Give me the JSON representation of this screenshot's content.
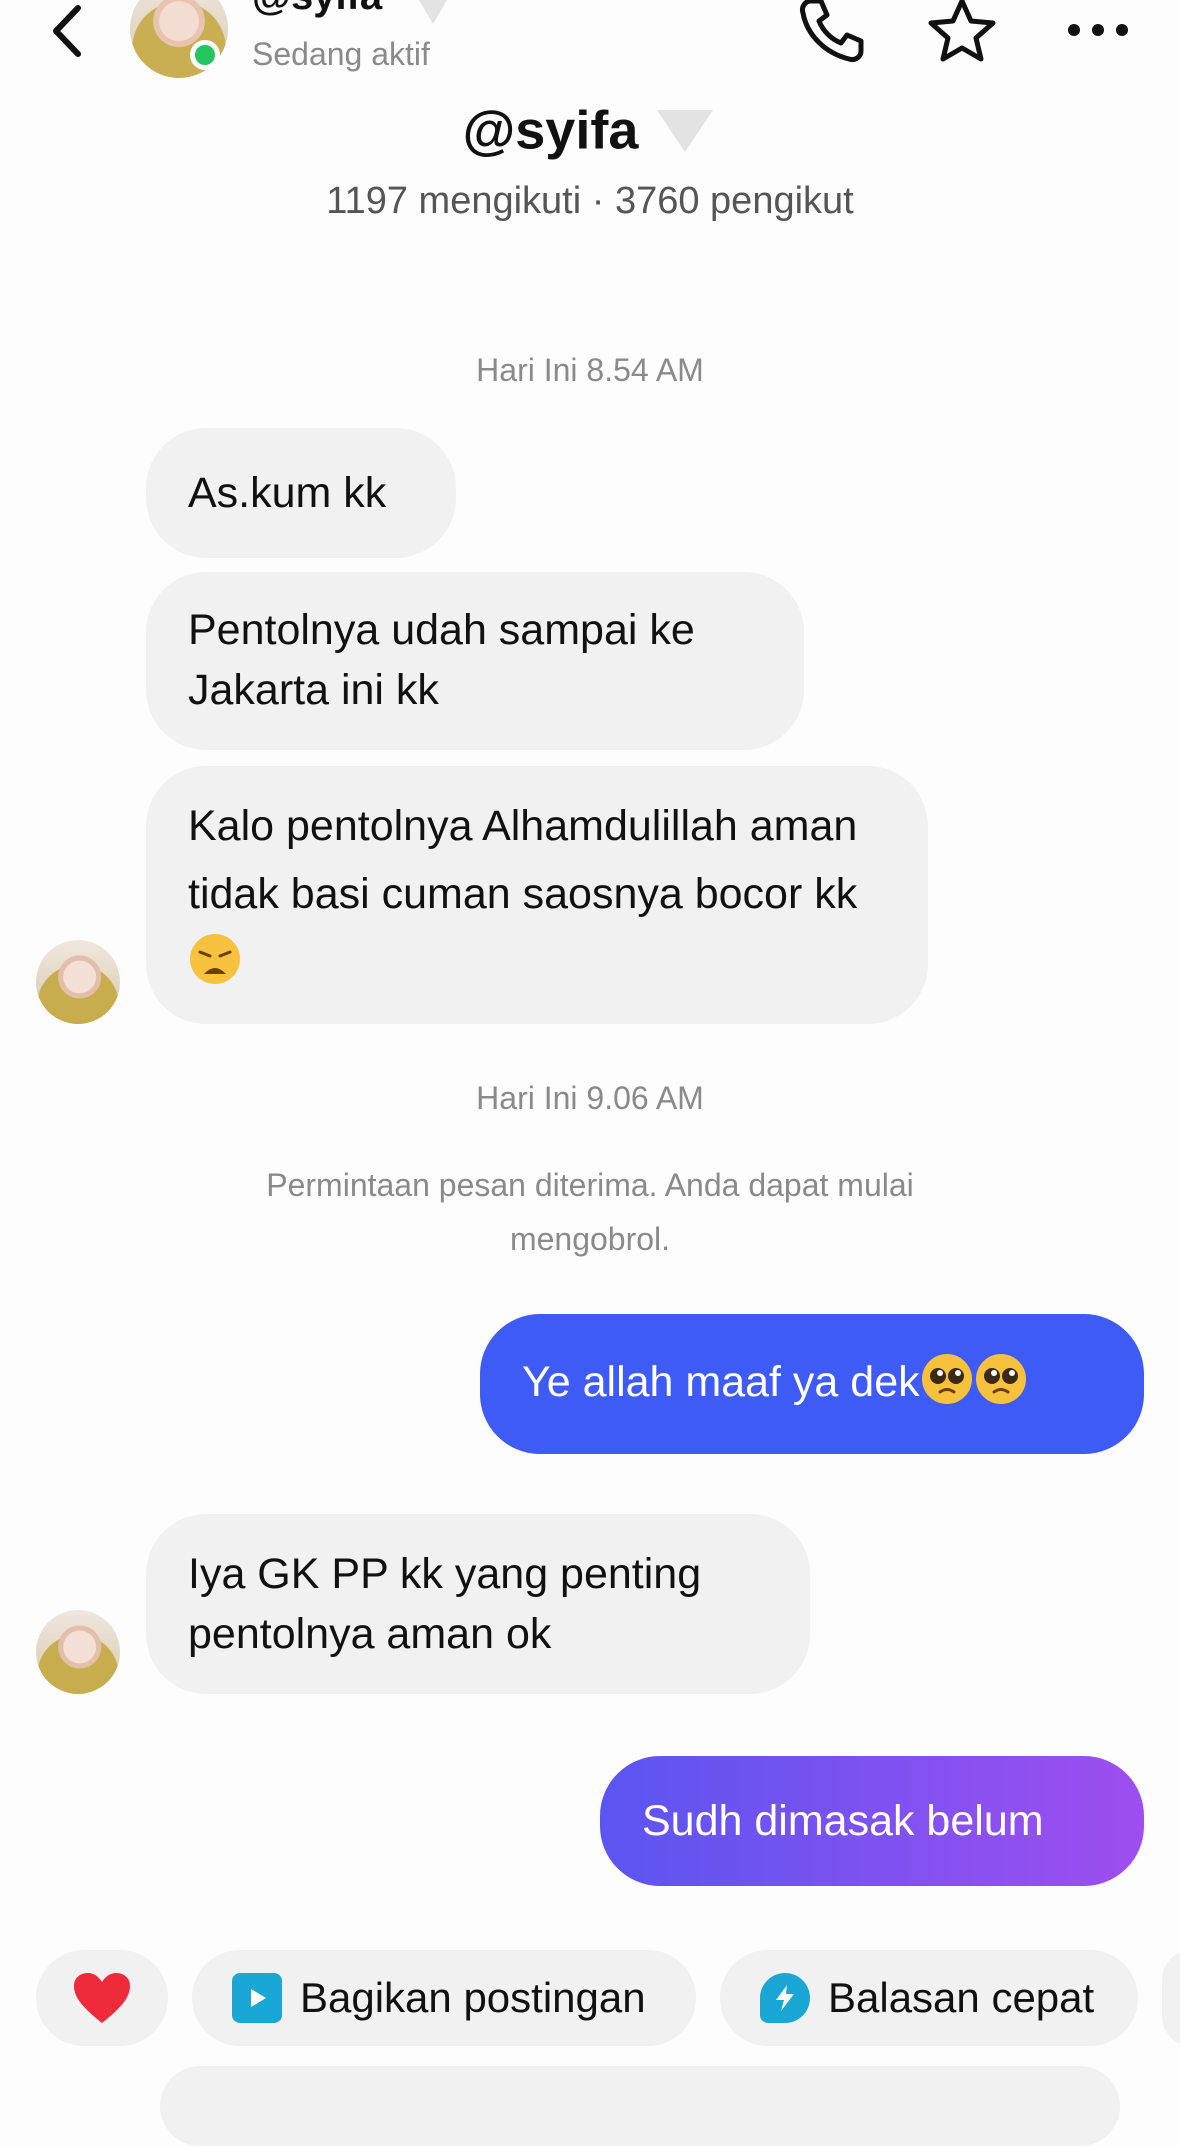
{
  "header": {
    "handle": "@syifa",
    "status": "Sedang aktif",
    "icons": [
      "back-icon",
      "phone-icon",
      "star-icon",
      "more-icon"
    ]
  },
  "profile": {
    "name": "@syifa",
    "stats": "1197 mengikuti · 3760 pengikut"
  },
  "conversation": {
    "timestamp_1": "Hari Ini 8.54 AM",
    "timestamp_2": "Hari Ini 9.06 AM",
    "system_note": "Permintaan pesan diterima. Anda dapat mulai mengobrol.",
    "messages": [
      {
        "from": "them",
        "text": "As.kum kk"
      },
      {
        "from": "them",
        "text": "Pentolnya udah sampai ke Jakarta ini kk"
      },
      {
        "from": "them",
        "text": "Kalo pentolnya Alhamdulillah aman tidak basi cuman saosnya bocor kk",
        "emoji": "weary-face-emoji"
      },
      {
        "from": "me",
        "text": "Ye allah maaf ya dek",
        "emoji": "pleading-face-emoji"
      },
      {
        "from": "them",
        "text": "Iya GK PP kk yang penting pentolnya aman ok"
      },
      {
        "from": "me",
        "text": "Sudh dimasak belum"
      }
    ]
  },
  "quick_actions": {
    "share_post": "Bagikan postingan",
    "quick_reply": "Balasan cepat"
  },
  "colors": {
    "sent_bubble": "#3e5bf5",
    "sent_bubble_gradient_end": "#9f4ef0",
    "received_bubble": "#f1f1f1",
    "online": "#22c55e"
  }
}
